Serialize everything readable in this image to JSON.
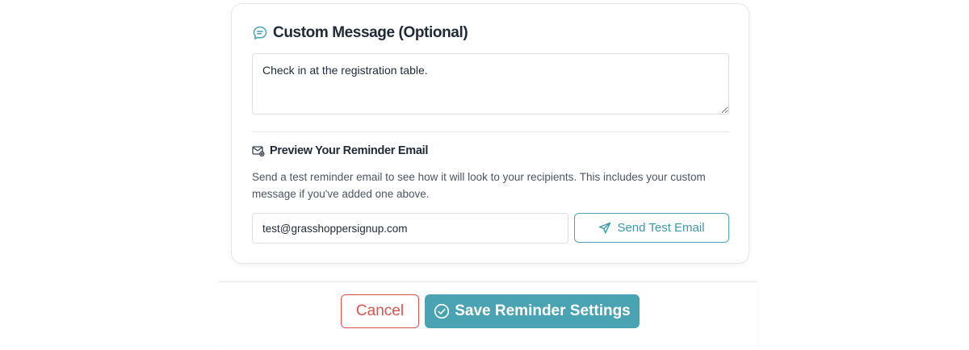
{
  "custom_message": {
    "title": "Custom Message (Optional)",
    "title_icon": "chat-bubble-icon",
    "value": "Check in at the registration table."
  },
  "preview": {
    "title": "Preview Your Reminder Email",
    "title_icon": "mail-settings-icon",
    "description": "Send a test reminder email to see how it will look to your recipients. This includes your custom message if you've added one above.",
    "test_email_value": "test@grasshoppersignup.com",
    "send_button_label": "Send Test Email",
    "send_button_icon": "paper-plane-icon"
  },
  "footer": {
    "cancel_label": "Cancel",
    "save_label": "Save Reminder Settings",
    "save_icon": "check-circle-icon"
  },
  "colors": {
    "accent": "#4aa3b3",
    "danger": "#d9534f",
    "text": "#1f2937",
    "muted_text": "#4b5563",
    "border": "#d9dee5"
  }
}
